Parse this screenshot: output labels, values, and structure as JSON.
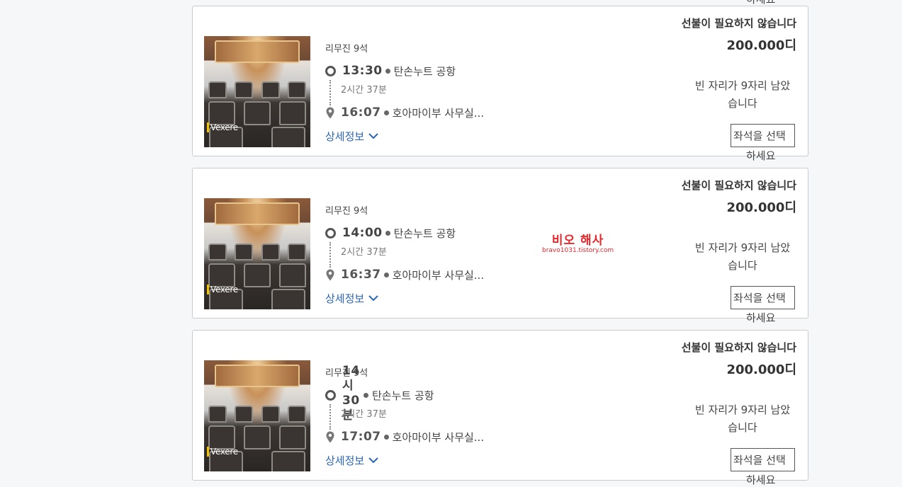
{
  "cards": [
    {
      "bus_type": "리무진 9석",
      "departure_time": "13:30",
      "departure_place": "탄손누트 공항",
      "duration": "2시간 37분",
      "arrival_time": "16:07",
      "arrival_place": "호아마이부 사무실...",
      "details_label": "상세정보",
      "prepay_label": "선불이 필요하지 않습니다",
      "price": "200.000디",
      "seats_left": "빈 자리가 9자리 남았습니다",
      "select_label_1": "좌석을 선택",
      "select_label_2": "하세요",
      "brand": "Vexere"
    },
    {
      "bus_type": "리무진 9석",
      "departure_time": "14:00",
      "departure_place": "탄손누트 공항",
      "duration": "2시간 37분",
      "arrival_time": "16:37",
      "arrival_place": "호아마이부 사무실...",
      "details_label": "상세정보",
      "prepay_label": "선불이 필요하지 않습니다",
      "price": "200.000디",
      "seats_left": "빈 자리가 9자리 남았습니다",
      "select_label_1": "좌석을 선택",
      "select_label_2": "하세요",
      "brand": "Vexere"
    },
    {
      "bus_type": "리무진 9석",
      "departure_time": "14시 30분",
      "departure_place": "탄손누트 공항",
      "duration": "2시간 37분",
      "arrival_time": "17:07",
      "arrival_place": "호아마이부 사무실...",
      "details_label": "상세정보",
      "prepay_label": "선불이 필요하지 않습니다",
      "price": "200.000디",
      "seats_left": "빈 자리가 9자리 남았습니다",
      "select_label_1": "좌석을 선택",
      "select_label_2": "하세요",
      "brand": "Vexere"
    }
  ],
  "top_cut_text": "하세요",
  "watermark": {
    "main": "비오 해사",
    "sub": "bravo1031.tistory.com"
  },
  "colors": {
    "link": "#2a66b8",
    "watermark": "#e8272b",
    "border": "#c8cbcf"
  }
}
